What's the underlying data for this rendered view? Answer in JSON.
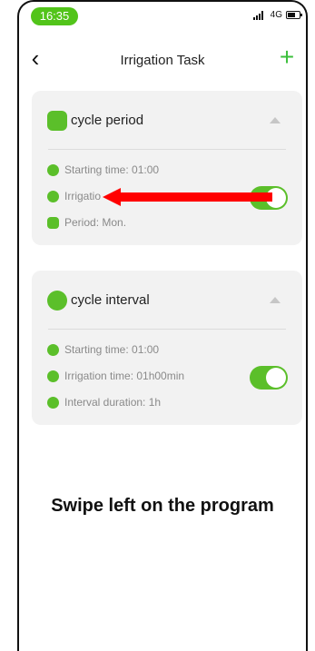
{
  "status_bar": {
    "time": "16:35",
    "network": "4G"
  },
  "header": {
    "back_label": "‹",
    "title": "Irrigation Task",
    "add_label": "+"
  },
  "cards": [
    {
      "title": "cycle period",
      "rows": [
        {
          "label": "Starting time: 01:00"
        },
        {
          "label": "Irrigatio"
        },
        {
          "label": "Period: Mon."
        }
      ],
      "enabled": true
    },
    {
      "title": "cycle interval",
      "rows": [
        {
          "label": "Starting time: 01:00"
        },
        {
          "label": "Irrigation time: 01h00min"
        },
        {
          "label": "Interval duration: 1h"
        }
      ],
      "enabled": true
    }
  ],
  "instruction": "Swipe left on the program",
  "colors": {
    "accent": "#5bbf2a",
    "arrow": "#ff0000",
    "card_bg": "#f2f2f2"
  },
  "icons": [
    "calendar-icon",
    "clock-icon",
    "irrigation-icon",
    "period-icon",
    "timer-icon",
    "interval-icon"
  ]
}
